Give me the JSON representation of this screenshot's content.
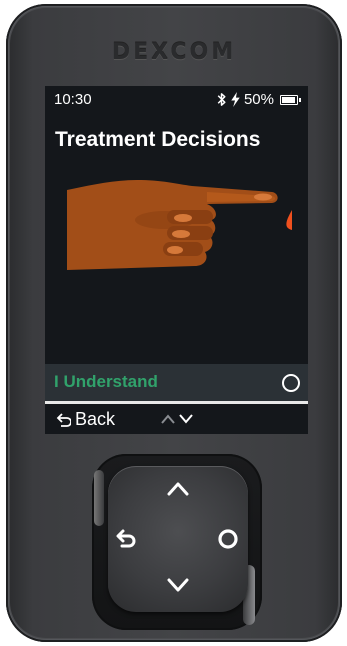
{
  "device": {
    "brand": "Dexcom"
  },
  "status_bar": {
    "time": "10:30",
    "battery_percent": "50%",
    "battery_level": 0.8,
    "icons": [
      "bluetooth-icon",
      "charging-bolt-icon",
      "battery-icon"
    ]
  },
  "screen": {
    "title": "Treatment Decisions",
    "illustration": "finger-blood-drop",
    "option": {
      "label": "I Understand",
      "icon": "select-circle-icon",
      "color": "#31a26b"
    },
    "bottom_bar": {
      "back_label": "Back"
    }
  },
  "dpad": {
    "buttons": [
      "up-icon",
      "down-icon",
      "back-icon",
      "select-circle-icon"
    ]
  }
}
